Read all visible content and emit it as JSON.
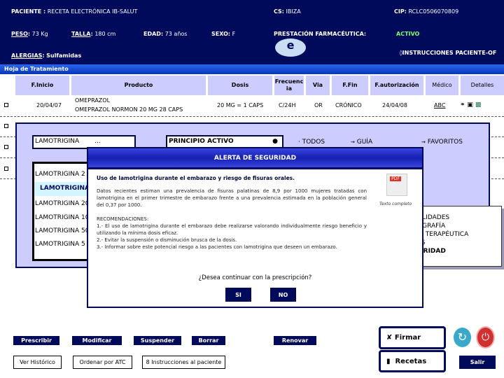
{
  "header": {
    "paciente_label": "PACIENTE :",
    "paciente": "RECETA ELECTRÓNICA IB-SALUT",
    "cs_label": "CS:",
    "cs": "IBIZA",
    "cip_label": "CIP:",
    "cip": "RCLC0506070809",
    "peso_label": "PESO",
    "peso": "73 Kg",
    "talla_label": "TALLA",
    "talla": "180 cm",
    "edad_label": "EDAD:",
    "edad": "73 años",
    "sexo_label": "SEXO:",
    "sexo": "F",
    "prestacion_label": "PRESTACIÓN FARMACÉUTICA:",
    "prestacion": "ACTIVO",
    "e_logo": "e",
    "instrucciones": "◊INSTRUCCIONES PACIENTE-OF",
    "alergias_label": "ALERGIAS",
    "alergias": "Sulfamidas"
  },
  "section_title": "Hoja de Tratamiento",
  "table": {
    "columns": [
      "F.Inicio",
      "Producto",
      "Dosis",
      "Frecuencia",
      "Via",
      "F.Fin",
      "F.autorización",
      "Médico",
      "Detalles"
    ],
    "rows": [
      {
        "f_inicio": "20/04/07",
        "producto": "OMEPRAZOL",
        "producto_detalle": "OMEPRAZOL NORMON 20 MG 28 CAPS",
        "dosis": "20 MG = 1 CAPS",
        "frecuencia": "C/24H",
        "via": "OR",
        "f_fin": "CRÓNICO",
        "f_autorizacion": "24/04/08",
        "medico": "ABC"
      }
    ]
  },
  "search": {
    "value": "LAMOTRIGINA",
    "more": "...",
    "mode": "PRINCIPIO ACTIVO",
    "todos": "· TODOS",
    "guia": "GUÍA",
    "favoritos": "FAVORITOS",
    "results": [
      "LAMOTRIGINA 2 M",
      "LAMOTRIGINA",
      "LAMOTRIGINA 20",
      "LAMOTRIGINA 10",
      "LAMOTRIGINA 50",
      "LAMOTRIGINA 5 M"
    ],
    "actions": [
      "CAR ESPECIALIDADES",
      "ULTAR MONOGRAFÍA",
      "DE NOVEDAD TERAPÉUTICA",
      "TERACCIONES",
      "AS DE SEGURIDAD"
    ]
  },
  "alert": {
    "title": "ALERTA DE SEGURIDAD",
    "heading": "Uso de lamotrigina durante el embarazo y riesgo de fisuras orales.",
    "body": "Datos recientes estiman una prevalencia de fisuras palatinas de 8,9 por 1000 mujeres tratadas con lamotrigina en el primer trimestre de embarazo frente a una prevalencia estimada en la población general del 0,37 por 1000.",
    "rec_title": "RECOMENDACIONES:",
    "recs": [
      "1.- El uso de lamotrigina durante el embarazo debe realizarse valorando individualmente riesgo beneficio y utilizando la mínima dosis eficaz.",
      "2.- Evitar la suspensión o disminución brusca de la dosis.",
      "3.- Informar sobre este potencial riesgo a las pacientes con lamotrigina que deseen un embarazo."
    ],
    "pdf_caption": "Texto completo",
    "question": "¿Desea continuar con la prescripción?",
    "yes": "SI",
    "no": "NO"
  },
  "footer": {
    "prescribir": "Prescribir",
    "modificar": "Modificar",
    "suspender": "Suspender",
    "borrar": "Borrar",
    "renovar": "Renovar",
    "ver_historico": "Ver Histórico",
    "ordenar": "Ordenar por ATC",
    "instrucciones": "8 Instrucciones al paciente",
    "firmar": "Firmar",
    "recetas": "Recetas",
    "salir": "Salir"
  },
  "colors": {
    "header_bg": "#000a5a",
    "active": "#7cff6a",
    "table_header": "#ccccff"
  }
}
